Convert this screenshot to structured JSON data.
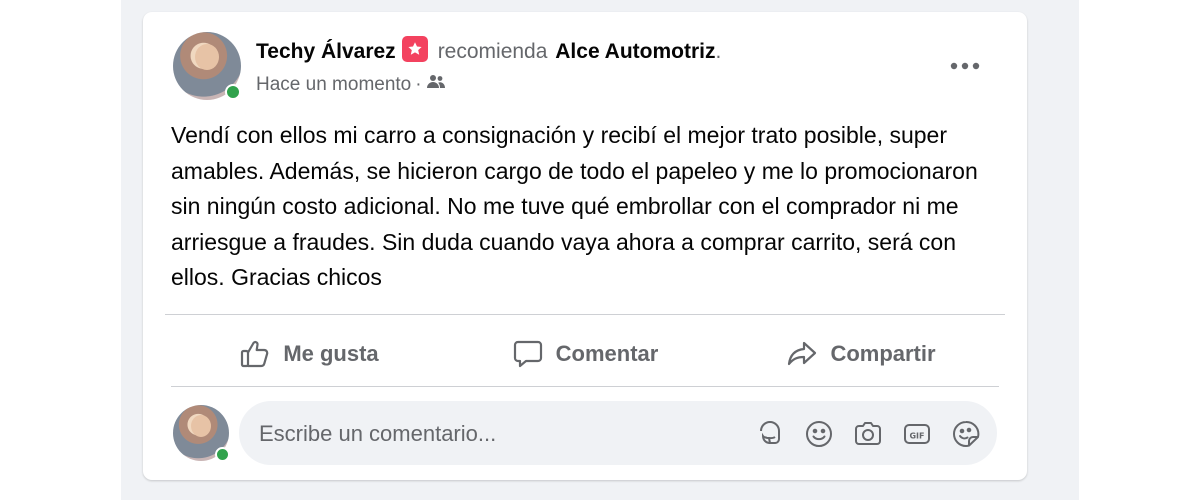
{
  "post": {
    "author": "Techy Álvarez",
    "badge_icon": "recommendation-star-icon",
    "recommends_text": "recomienda",
    "page_name": "Alce Automotriz",
    "trailing_dot": ".",
    "time": "Hace un momento",
    "separator": "·",
    "audience_icon": "friends-icon",
    "more_icon": "more-options-icon",
    "body": "Vendí con ellos mi carro a consignación y recibí el mejor trato posible, super amables. Además, se hicieron cargo de todo el papeleo y me lo promocionaron sin ningún costo adicional. No me tuve qué embrollar con el comprador ni me arriesgue a fraudes. Sin duda cuando vaya ahora a comprar carrito, será con ellos. Gracias chicos"
  },
  "actions": {
    "like_label": "Me gusta",
    "comment_label": "Comentar",
    "share_label": "Compartir"
  },
  "comment_box": {
    "placeholder": "Escribe un comentario...",
    "icons": [
      "avatar-sticker-icon",
      "emoji-icon",
      "camera-icon",
      "gif-icon",
      "sticker-icon"
    ]
  },
  "colors": {
    "badge": "#f3425f",
    "online": "#31a24c",
    "secondary_text": "#65676b",
    "feed_background": "#f0f2f5"
  }
}
